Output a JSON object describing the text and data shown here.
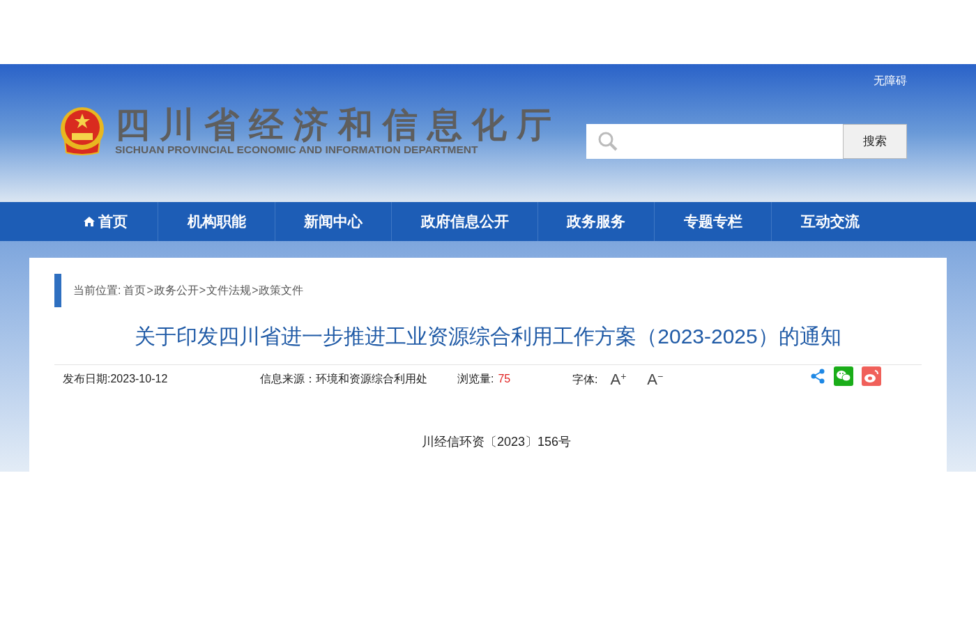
{
  "header": {
    "accessibility_link": "无障碍",
    "site_title": "四川省经济和信息化厅",
    "site_subtitle": "SICHUAN PROVINCIAL ECONOMIC AND INFORMATION DEPARTMENT",
    "search": {
      "button": "搜索"
    }
  },
  "nav": [
    {
      "label": "首页",
      "kind": "home"
    },
    {
      "label": "机构职能",
      "kind": "plain"
    },
    {
      "label": "新闻中心",
      "kind": "plain"
    },
    {
      "label": "政府信息公开",
      "kind": "plain"
    },
    {
      "label": "政务服务",
      "kind": "plain"
    },
    {
      "label": "专题专栏",
      "kind": "plain"
    },
    {
      "label": "互动交流",
      "kind": "plain"
    }
  ],
  "breadcrumb": {
    "label": "当前位置:",
    "separator": ">",
    "items": [
      "首页",
      "政务公开",
      "文件法规",
      "政策文件"
    ]
  },
  "article": {
    "title": "关于印发四川省进一步推进工业资源综合利用工作方案（2023-2025）的通知",
    "meta": {
      "date": "发布日期:2023-10-12",
      "source": "信息来源：环境和资源综合利用处",
      "views_label": "浏览量:",
      "views": "75",
      "font_label": "字体:",
      "font_controls": [
        {
          "letter": "A",
          "sign": "+"
        },
        {
          "letter": "A",
          "sign": "−"
        }
      ]
    },
    "share": [
      {
        "kind": "share"
      },
      {
        "kind": "wechat"
      },
      {
        "kind": "weibo"
      }
    ],
    "doc_number": "川经信环资〔2023〕156号"
  }
}
